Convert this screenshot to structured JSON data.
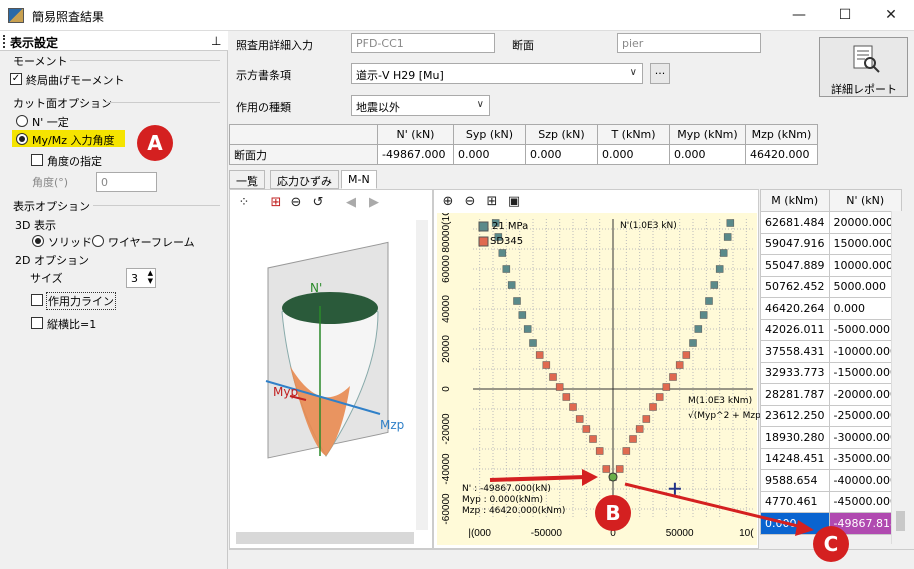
{
  "window": {
    "title": "簡易照査結果",
    "minimize": "—",
    "maximize": "☐",
    "close": "✕"
  },
  "panel": {
    "title": "表示設定",
    "pin": "⊥",
    "moment_group": "モーメント",
    "ultimate_moment": "終局曲げモーメント",
    "cut_group": "カット面オプション",
    "n_const": "N' 一定",
    "mymz_angle": "My/Mz 入力角度",
    "angle_specify": "角度の指定",
    "angle_label": "角度(°)",
    "angle_value": "0",
    "display_group": "表示オプション",
    "display3d": "3D 表示",
    "solid": "ソリッド",
    "wireframe": "ワイヤーフレーム",
    "display2d": "2D オプション",
    "size_label": "サイズ",
    "size_value": "3",
    "action_line": "作用力ライン",
    "aspect_ratio": "縦横比=1"
  },
  "form": {
    "detail_input_label": "照査用詳細入力",
    "detail_input_value": "PFD-CC1",
    "section_label": "断面",
    "section_value": "pier",
    "spec_label": "示方書条項",
    "spec_value": "道示-V H29 [Mu]",
    "spec_button": "...",
    "action_type_label": "作用の種類",
    "action_type_value": "地震以外",
    "report_button": "詳細レポート"
  },
  "force_table": {
    "headers": [
      "N' (kN)",
      "Syp (kN)",
      "Szp (kN)",
      "T (kNm)",
      "Myp (kNm)",
      "Mzp (kNm)"
    ],
    "row_label": "断面力",
    "values": [
      "-49867.000",
      "0.000",
      "0.000",
      "0.000",
      "0.000",
      "46420.000"
    ]
  },
  "tabs": [
    "一覧",
    "応力ひずみ",
    "M-N"
  ],
  "view3d": {
    "n_axis": "N'",
    "myp_axis": "Myp",
    "mzp_axis": "Mzp"
  },
  "chart": {
    "legend1": "21 MPa",
    "legend2": "SD345",
    "top_axis_label": "N'(1.0E3 kN)",
    "right_axis_label": "M(1.0E3 kNm)",
    "right_axis_sub": "√(Myp^2 + Mzp^2)",
    "x_ticks": [
      "-100000",
      "-50000",
      "0",
      "50000",
      "100000"
    ],
    "x_tick_text": [
      "|(000",
      "-50000",
      "0",
      "50000",
      "10("
    ],
    "y_ticks": [
      "80000(1C)",
      "60000",
      "40000",
      "20000",
      "0",
      "-20000",
      "-40000",
      "-60000"
    ],
    "info_n": "N' : -49867.000(kN)",
    "info_myp": "Myp : 0.000(kNm)",
    "info_mzp": "Mzp : 46420.000(kNm)"
  },
  "chart_data": {
    "type": "scatter",
    "series": [
      {
        "name": "21 MPa",
        "x": [
          -88000,
          -86000,
          -83000,
          -80000,
          -76000,
          -72000,
          -68000,
          -64000,
          -60000,
          -55000,
          -50000,
          -45000,
          -40000,
          -35000,
          -30000,
          -25000,
          -20000,
          -15000,
          -10000,
          -5000,
          0
        ],
        "y": [
          83000,
          76000,
          68000,
          60000,
          52000,
          44000,
          37000,
          30000,
          23000,
          17000,
          12000,
          6000,
          1000,
          -4000,
          -9000,
          -15000,
          -20000,
          -25000,
          -31000,
          -40000,
          -44000
        ]
      },
      {
        "name": "SD345",
        "x": [
          88000,
          86000,
          83000,
          80000,
          76000,
          72000,
          68000,
          64000,
          60000,
          55000,
          50000,
          45000,
          40000,
          35000,
          30000,
          25000,
          20000,
          15000,
          10000,
          5000
        ],
        "y": [
          83000,
          76000,
          68000,
          60000,
          52000,
          44000,
          37000,
          30000,
          23000,
          17000,
          12000,
          6000,
          1000,
          -4000,
          -9000,
          -15000,
          -20000,
          -25000,
          -31000,
          -40000
        ]
      }
    ],
    "marked_point": {
      "x": 0,
      "y": -44000
    },
    "action_point": {
      "x": 46420,
      "y": -49867
    },
    "xlim": [
      -105000,
      105000
    ],
    "ylim": [
      -65000,
      85000
    ],
    "grid": true
  },
  "mn_table": {
    "headers": [
      "M (kNm)",
      "N' (kN)"
    ],
    "rows": [
      [
        "62681.484",
        "20000.000"
      ],
      [
        "59047.916",
        "15000.000"
      ],
      [
        "55047.889",
        "10000.000"
      ],
      [
        "50762.452",
        "5000.000"
      ],
      [
        "46420.264",
        "0.000"
      ],
      [
        "42026.011",
        "-5000.000"
      ],
      [
        "37558.431",
        "-10000.000"
      ],
      [
        "32933.773",
        "-15000.000"
      ],
      [
        "28281.787",
        "-20000.000"
      ],
      [
        "23612.250",
        "-25000.000"
      ],
      [
        "18930.280",
        "-30000.000"
      ],
      [
        "14248.451",
        "-35000.000"
      ],
      [
        "9588.654",
        "-40000.000"
      ],
      [
        "4770.461",
        "-45000.000"
      ],
      [
        "0.000",
        "-49867.818"
      ]
    ]
  },
  "callouts": {
    "a": "A",
    "b": "B",
    "c": "C"
  },
  "colors": {
    "accent_highlight": "#f5e400",
    "callout": "#d42020",
    "selected_row": "#0a64d0",
    "selected_cell": "#b04ab0"
  }
}
